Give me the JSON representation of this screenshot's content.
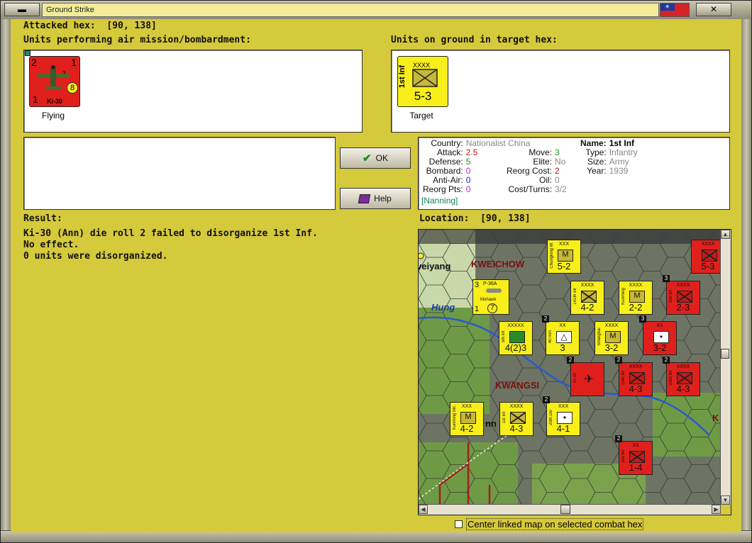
{
  "window": {
    "title": "Ground Strike"
  },
  "header": {
    "attacked_hex_label": "Attacked hex:",
    "attacked_hex_value": "[90, 138]"
  },
  "air_units": {
    "label": "Units performing air mission/bombardment:",
    "unit": {
      "type_label": "Ki-30",
      "status": "Flying",
      "range_circle": "8",
      "top_left": "2",
      "top_right": "1",
      "bottom_left": "1",
      "mid_right": "3"
    }
  },
  "ground_units": {
    "label": "Units on ground in target hex:",
    "unit": {
      "name": "1st Inf",
      "size": "XXXX",
      "strength": "5-3",
      "status": "Target"
    }
  },
  "buttons": {
    "ok": "OK",
    "help": "Help"
  },
  "info": {
    "country_k": "Country:",
    "country_v": "Nationalist China",
    "attack_k": "Attack:",
    "attack_v": "2.5",
    "defense_k": "Defense:",
    "defense_v": "5",
    "bombard_k": "Bombard:",
    "bombard_v": "0",
    "antiair_k": "Anti-Air:",
    "antiair_v": "0",
    "reorg_pts_k": "Reorg Pts:",
    "reorg_pts_v": "0",
    "location_link": "[Nanning]",
    "move_k": "Move:",
    "move_v": "3",
    "elite_k": "Elite:",
    "elite_v": "No",
    "reorg_cost_k": "Reorg Cost:",
    "reorg_cost_v": "2",
    "oil_k": "Oil:",
    "oil_v": "0",
    "cost_turns_k": "Cost/Turns:",
    "cost_turns_v": "3/2",
    "name_k": "Name:",
    "name_v": "1st Inf",
    "type_k": "Type:",
    "type_v": "Infantry",
    "size_k": "Size:",
    "size_v": "Army",
    "year_k": "Year:",
    "year_v": "1939",
    "colors": {
      "attack": "#c0141c",
      "defense": "#18a018",
      "bombard": "#d020d0",
      "antiair": "#2020c8",
      "reorg_pts": "#c020c0",
      "reorg_cost": "#c0141c",
      "link": "#108060"
    }
  },
  "result": {
    "label": "Result:",
    "lines": [
      "Ki-30 (Ann) die roll 2 failed to disorganize 1st Inf.",
      "No effect.",
      "0 units were disorganized."
    ]
  },
  "location": {
    "label": "Location:",
    "value": "[90, 138]"
  },
  "map": {
    "labels": {
      "weiyang": "veiyang",
      "kweichow": "KWEICHOW",
      "hung": "Hung",
      "kwangsi": "KWANGSI",
      "nn": "nn",
      "k": "K"
    },
    "counters": [
      {
        "name": "Chungking W.",
        "size": "XXX",
        "val": "5-2",
        "color": "y",
        "sym": "M",
        "stack": ""
      },
      {
        "name": "",
        "size": "XXXX",
        "val": "5-3",
        "color": "r",
        "sym": "X",
        "stack": ""
      },
      {
        "name": "141th Inf",
        "size": "XXXX",
        "val": "4-2",
        "color": "y",
        "sym": "X",
        "stack": ""
      },
      {
        "name": "Kunming",
        "size": "XXXX",
        "val": "2-2",
        "color": "y",
        "sym": "M",
        "stack": ""
      },
      {
        "name": "2nd Inf",
        "size": "XXXX",
        "val": "2-3",
        "color": "r",
        "sym": "X",
        "stack": "3"
      },
      {
        "name": "5th Inf",
        "size": "XXXXX",
        "val": "4(2)3",
        "color": "y",
        "sym": "G",
        "stack": ""
      },
      {
        "name": "40 mm",
        "size": "XX",
        "val": "3",
        "color": "y",
        "sym": "A",
        "stack": "2"
      },
      {
        "name": "Shanghai",
        "size": "XXXX",
        "val": "3-2",
        "color": "y",
        "sym": "M",
        "stack": ""
      },
      {
        "name": "",
        "size": "XX",
        "val": "3-2",
        "color": "r",
        "sym": "D",
        "stack": "3"
      },
      {
        "name": "Ki-30",
        "size": "",
        "val": "",
        "color": "r",
        "sym": "P",
        "stack": "2"
      },
      {
        "name": "15th Inf",
        "size": "XXXX",
        "val": "4-3",
        "color": "r",
        "sym": "X",
        "stack": "2"
      },
      {
        "name": "23rd Inf",
        "size": "XXXX",
        "val": "4-3",
        "color": "r",
        "sym": "X",
        "stack": "2"
      },
      {
        "name": "Kunming Mil.",
        "size": "XXX",
        "val": "4-2",
        "color": "y",
        "sym": "M",
        "stack": ""
      },
      {
        "name": "1st Inf",
        "size": "XXXX",
        "val": "4-3",
        "color": "y",
        "sym": "X",
        "stack": ""
      },
      {
        "name": "20th Div",
        "size": "XXX",
        "val": "4-1",
        "color": "y",
        "sym": "D",
        "stack": "2"
      },
      {
        "name": "2nd Inf",
        "size": "XX",
        "val": "1-4",
        "color": "r",
        "sym": "X",
        "stack": "2"
      }
    ],
    "aircraft": {
      "type": "P-36A",
      "owner": "Mohawk",
      "left": "3",
      "right": "1",
      "bottom_left": "1",
      "circle": "7"
    }
  },
  "checkbox": {
    "label": "Center linked map on selected combat hex",
    "checked": false
  }
}
